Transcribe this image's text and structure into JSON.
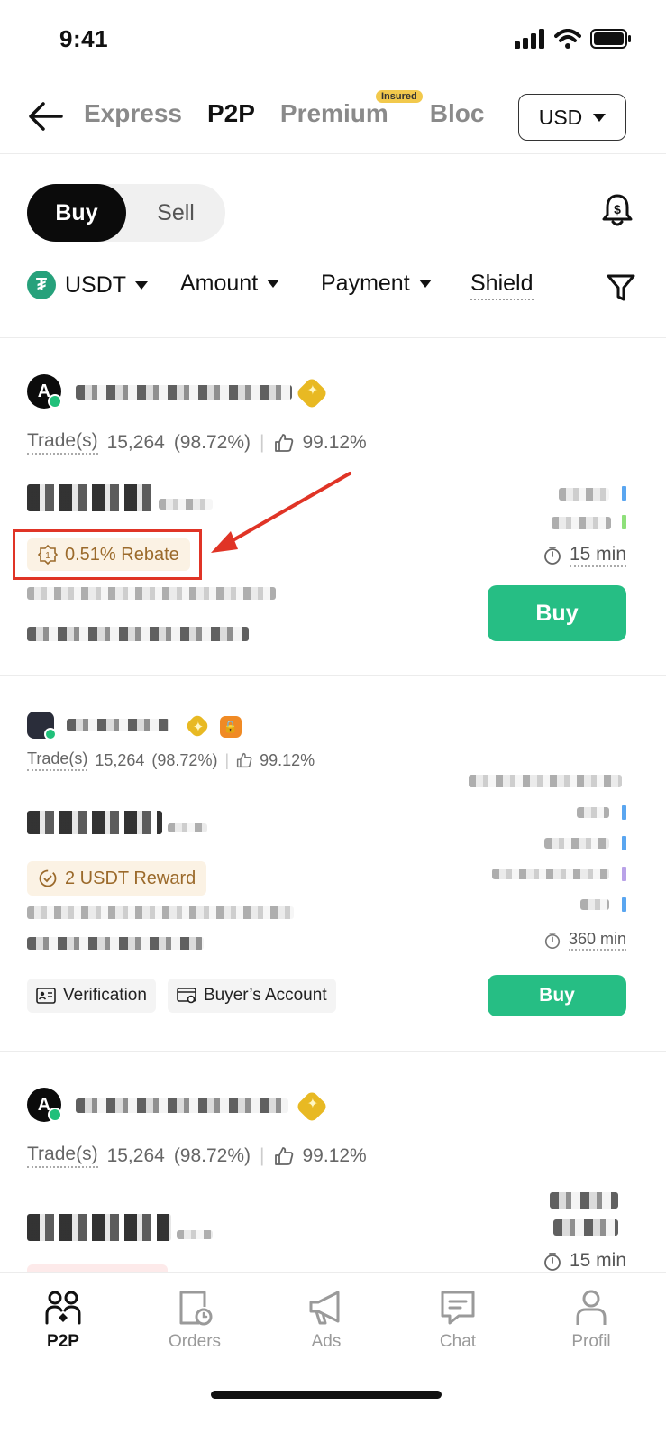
{
  "status_bar": {
    "time": "9:41"
  },
  "top_nav": {
    "tabs": [
      {
        "label": "Express",
        "active": false
      },
      {
        "label": "P2P",
        "active": true
      },
      {
        "label": "Premium",
        "active": false,
        "badge": "Insured"
      },
      {
        "label": "Bloc",
        "active": false
      }
    ],
    "currency": "USD"
  },
  "toggle": {
    "buy": "Buy",
    "sell": "Sell"
  },
  "filters": {
    "asset": "USDT",
    "amount": "Amount",
    "payment": "Payment",
    "shield": "Shield"
  },
  "cards": [
    {
      "avatar_letter": "A",
      "trades_label": "Trade(s)",
      "trades_count": "15,264",
      "trades_rate": "(98.72%)",
      "like_rate": "99.12%",
      "promo": "0.51% Rebate",
      "time": "15 min",
      "buy_label": "Buy"
    },
    {
      "trades_label": "Trade(s)",
      "trades_count": "15,264",
      "trades_rate": "(98.72%)",
      "like_rate": "99.12%",
      "promo": "2 USDT Reward",
      "time": "360 min",
      "tag_verification": "Verification",
      "tag_buyer_account": "Buyer’s Account",
      "buy_label": "Buy"
    },
    {
      "avatar_letter": "A",
      "trades_label": "Trade(s)",
      "trades_count": "15,264",
      "trades_rate": "(98.72%)",
      "like_rate": "99.12%",
      "time": "15 min"
    }
  ],
  "bottom_nav": [
    {
      "label": "P2P",
      "icon": "users-icon",
      "active": true
    },
    {
      "label": "Orders",
      "icon": "orders-icon",
      "active": false
    },
    {
      "label": "Ads",
      "icon": "megaphone-icon",
      "active": false
    },
    {
      "label": "Chat",
      "icon": "chat-icon",
      "active": false
    },
    {
      "label": "Profil",
      "icon": "profile-icon",
      "active": false
    }
  ],
  "colors": {
    "buy_green": "#26be84",
    "highlight_red": "#e03426",
    "promo_bg": "#fbf2e4",
    "promo_text": "#9b6a2b",
    "online_dot": "#20c07a"
  }
}
